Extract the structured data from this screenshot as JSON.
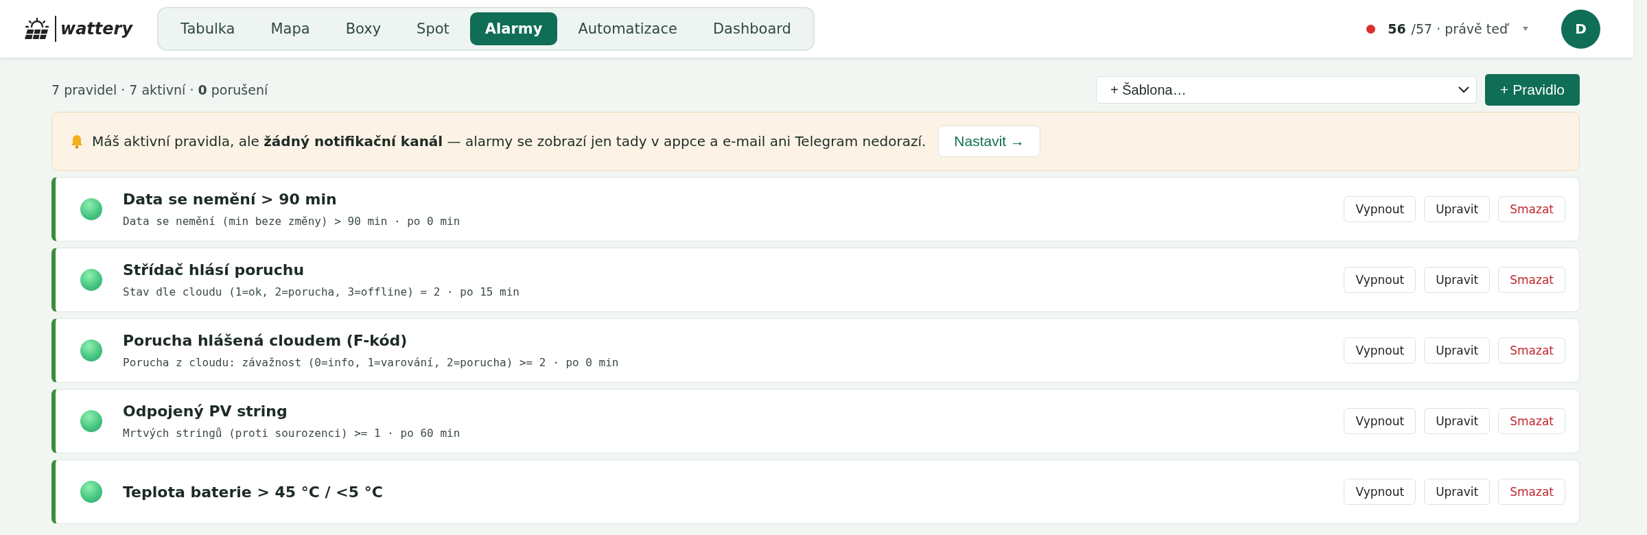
{
  "header": {
    "brand": "wattery",
    "nav": [
      {
        "label": "Tabulka",
        "selected": false
      },
      {
        "label": "Mapa",
        "selected": false
      },
      {
        "label": "Boxy",
        "selected": false
      },
      {
        "label": "Spot",
        "selected": false
      },
      {
        "label": "Alarmy",
        "selected": true
      },
      {
        "label": "Automatizace",
        "selected": false
      },
      {
        "label": "Dashboard",
        "selected": false
      }
    ],
    "status": {
      "color": "#dc2f2f",
      "count": "56",
      "rest": "/57 · právě teď"
    },
    "avatar": "D"
  },
  "summary": "7 pravidel · 7 aktivní · **0** porušení",
  "template_select": {
    "value": "+ Šablona…"
  },
  "add_button": "+ Pravidlo",
  "banner": {
    "text": "Máš aktivní pravidla, ale **žádný notifikační kanál** — alarmy se zobrazí jen tady v appce a e-mail ani Telegram nedorazí.",
    "button": "Nastavit →"
  },
  "rules": [
    {
      "title": "Data se nemění > 90 min",
      "detail": "Data se nemění (min beze změny) > 90 min · po 0 min",
      "active": true,
      "actions": [
        {
          "label": "Vypnout",
          "kind": "normal"
        },
        {
          "label": "Upravit",
          "kind": "normal"
        },
        {
          "label": "Smazat",
          "kind": "danger"
        }
      ]
    },
    {
      "title": "Střídač hlásí poruchu",
      "detail": "Stav dle cloudu (1=ok, 2=porucha, 3=offline) = 2 · po 15 min",
      "active": true,
      "actions": [
        {
          "label": "Vypnout",
          "kind": "normal"
        },
        {
          "label": "Upravit",
          "kind": "normal"
        },
        {
          "label": "Smazat",
          "kind": "danger"
        }
      ]
    },
    {
      "title": "Porucha hlášená cloudem (F-kód)",
      "detail": "Porucha z cloudu: závažnost (0=info, 1=varování, 2=porucha) >= 2 · po 0 min",
      "active": true,
      "actions": [
        {
          "label": "Vypnout",
          "kind": "normal"
        },
        {
          "label": "Upravit",
          "kind": "normal"
        },
        {
          "label": "Smazat",
          "kind": "danger"
        }
      ]
    },
    {
      "title": "Odpojený PV string",
      "detail": "Mrtvých stringů (proti sourozenci) >= 1 · po 60 min",
      "active": true,
      "actions": [
        {
          "label": "Vypnout",
          "kind": "normal"
        },
        {
          "label": "Upravit",
          "kind": "normal"
        },
        {
          "label": "Smazat",
          "kind": "danger"
        }
      ]
    },
    {
      "title": "Teplota baterie > 45 °C / <5 °C",
      "active": true,
      "actions": [
        {
          "label": "Vypnout",
          "kind": "normal"
        },
        {
          "label": "Upravit",
          "kind": "normal"
        },
        {
          "label": "Smazat",
          "kind": "danger"
        }
      ]
    }
  ]
}
